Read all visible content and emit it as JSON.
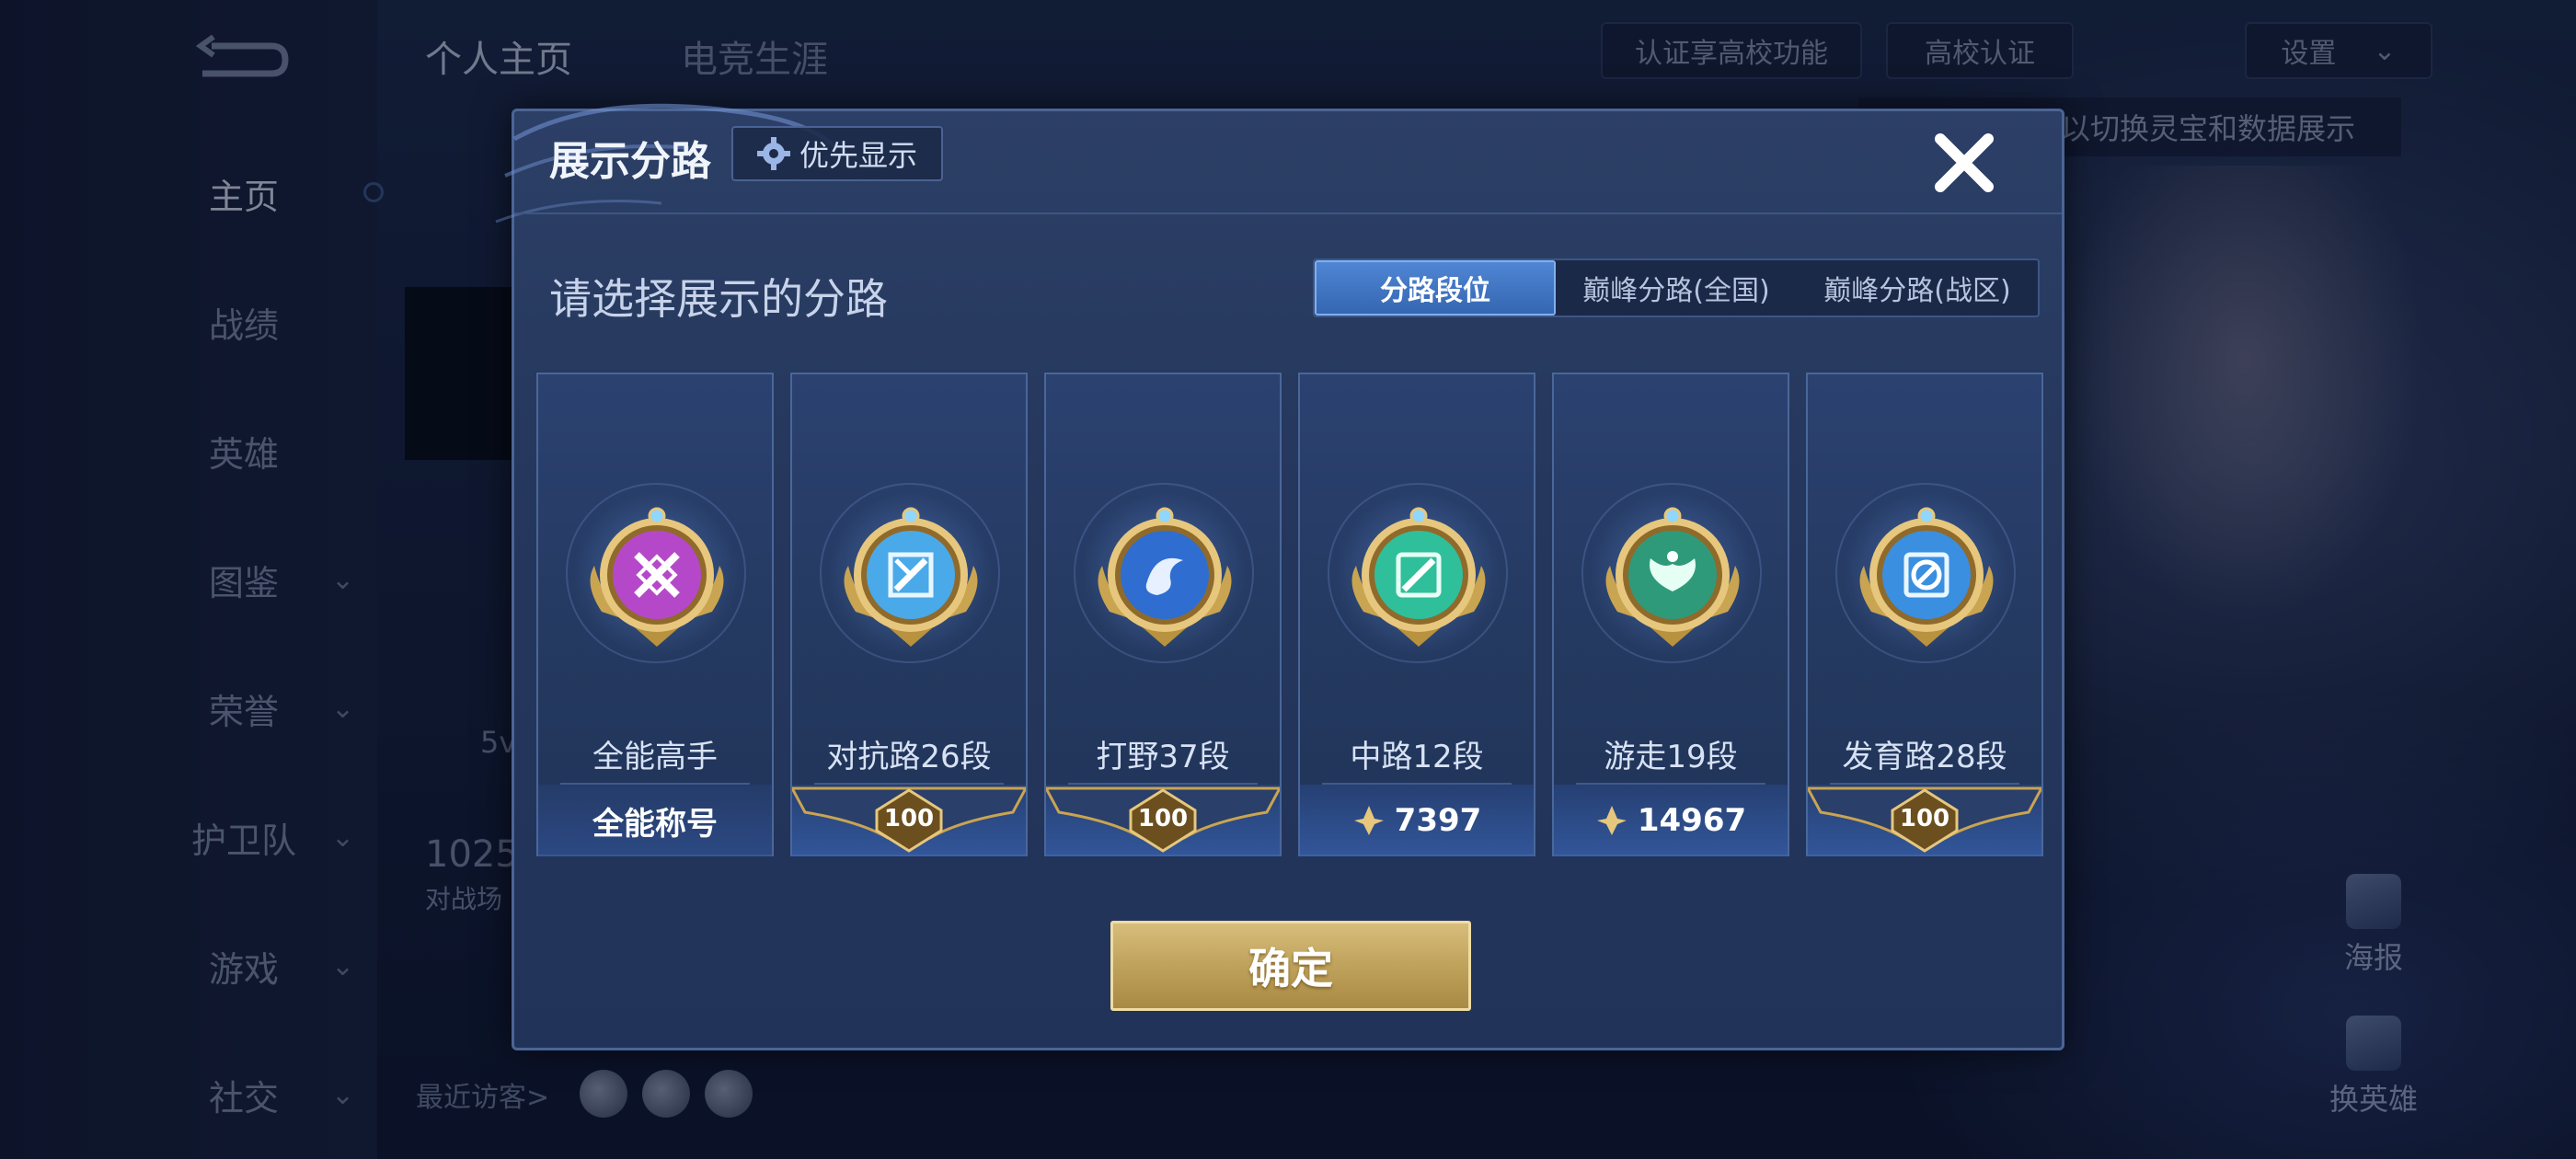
{
  "sidebar": {
    "items": [
      {
        "label": "主页",
        "chevron": false,
        "active": true
      },
      {
        "label": "战绩",
        "chevron": false
      },
      {
        "label": "英雄",
        "chevron": false
      },
      {
        "label": "图鉴",
        "chevron": true
      },
      {
        "label": "荣誉",
        "chevron": true
      },
      {
        "label": "护卫队",
        "chevron": true
      },
      {
        "label": "游戏",
        "chevron": true
      },
      {
        "label": "社交",
        "chevron": true
      }
    ]
  },
  "topbar": {
    "tabs": [
      "个人主页",
      "电竞生涯"
    ],
    "campus_hint": "认证享高校功能",
    "campus_cert": "高校认证",
    "settings": "设置"
  },
  "background": {
    "hint_text": "以切换灵宝和数据展示",
    "stat_1": "5v",
    "stat_2": "1025",
    "stat_3": "对战场",
    "visitors_label": "最近访客>",
    "poster_label": "海报",
    "switch_hero_label": "换英雄"
  },
  "dialog": {
    "title": "展示分路",
    "priority_label": "优先显示",
    "subtitle": "请选择展示的分路",
    "tabs": [
      {
        "label": "分路段位",
        "active": true
      },
      {
        "label": "巅峰分路(全国)",
        "active": false
      },
      {
        "label": "巅峰分路(战区)",
        "active": false
      }
    ],
    "cards": [
      {
        "name": "全能高手",
        "footer": "全能称号",
        "footer_type": "text",
        "badge_color": "#b548c9",
        "icon": "cross-icon"
      },
      {
        "name": "对抗路26段",
        "footer": "100",
        "footer_type": "ribbon",
        "badge_color": "#4aa9e8",
        "icon": "sword-icon"
      },
      {
        "name": "打野37段",
        "footer": "100",
        "footer_type": "ribbon",
        "badge_color": "#2f6ed0",
        "icon": "dragon-icon"
      },
      {
        "name": "中路12段",
        "footer": "7397",
        "footer_type": "score",
        "badge_color": "#2fbf9a",
        "icon": "wand-icon"
      },
      {
        "name": "游走19段",
        "footer": "14967",
        "footer_type": "score",
        "badge_color": "#2f9a7a",
        "icon": "wings-icon"
      },
      {
        "name": "发育路28段",
        "footer": "100",
        "footer_type": "ribbon",
        "badge_color": "#3a8fe0",
        "icon": "arrow-icon"
      }
    ],
    "confirm_label": "确定"
  }
}
